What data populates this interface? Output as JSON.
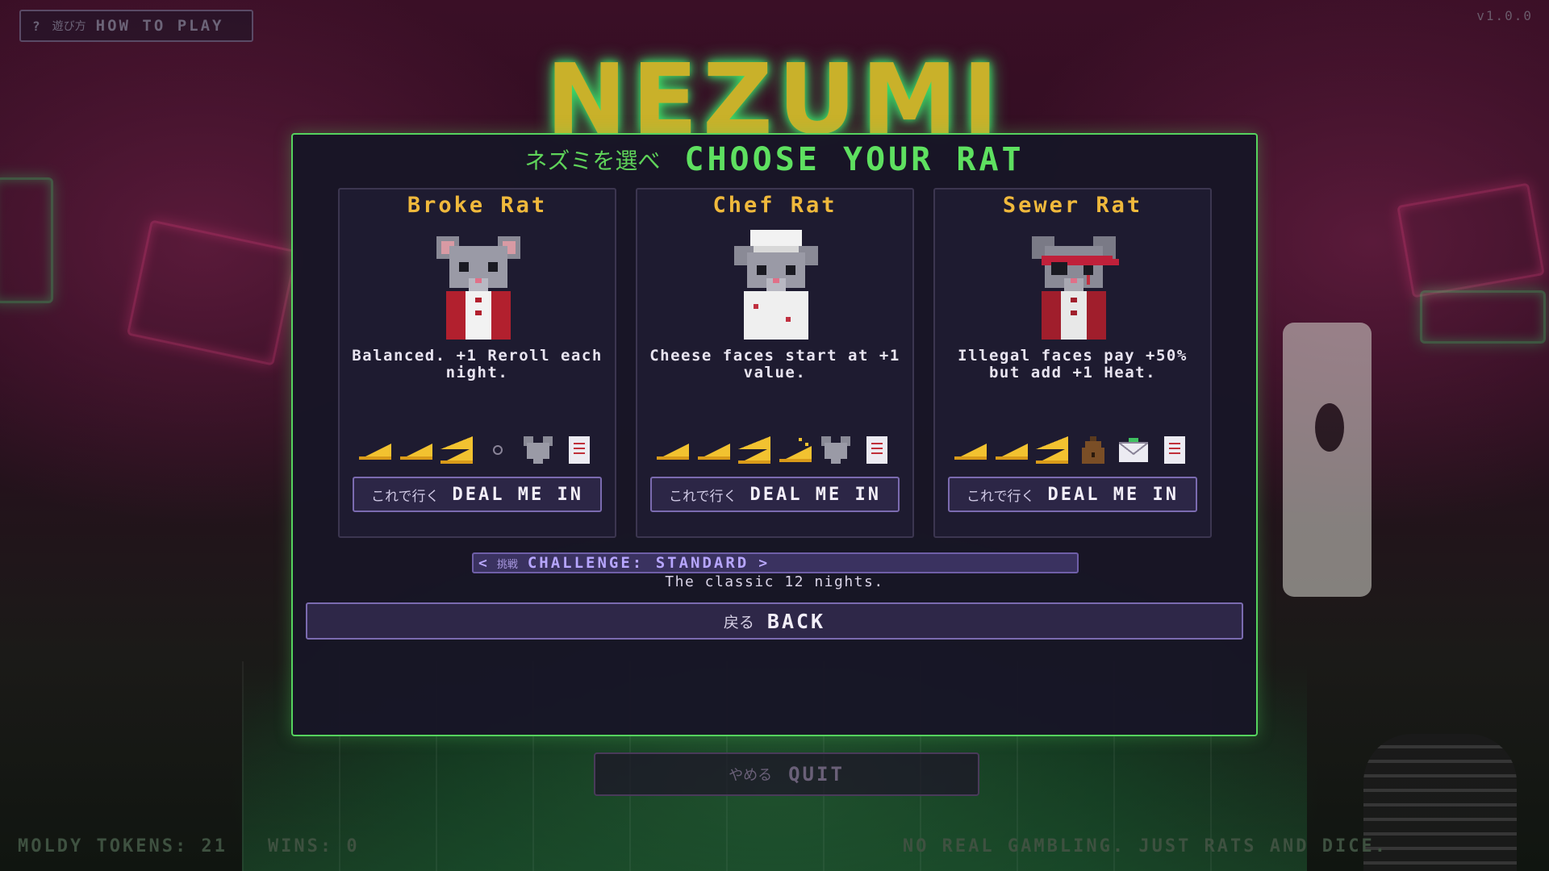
{
  "topbar": {
    "how_to_play_jp": "遊び方",
    "how_to_play_label": "HOW TO PLAY",
    "version": "v1.0.0"
  },
  "logo": "NEZUMI",
  "menu_behind": {
    "quit_jp": "やめる",
    "quit_label": "QUIT"
  },
  "footer": {
    "tokens": "MOLDY TOKENS: 21",
    "wins": "WINS: 0",
    "disclaimer": "NO REAL GAMBLING. JUST RATS AND DICE."
  },
  "modal": {
    "title_jp": "ネズミを選べ",
    "title": "CHOOSE YOUR RAT",
    "deal_jp": "これで行く",
    "deal_label": "DEAL ME IN",
    "rats": [
      {
        "name": "Broke Rat",
        "description": "Balanced. +1 Reroll each night.",
        "inventory": [
          "cheese-icon",
          "cheese-icon",
          "cheese-stack-icon",
          "empty-slot-icon",
          "rat-head-icon",
          "receipt-icon"
        ]
      },
      {
        "name": "Chef Rat",
        "description": "Cheese faces start at +1 value.",
        "inventory": [
          "cheese-icon",
          "cheese-icon",
          "cheese-stack-icon",
          "sparkle-cheese-icon",
          "rat-head-icon",
          "receipt-icon"
        ]
      },
      {
        "name": "Sewer Rat",
        "description": "Illegal faces pay +50% but add +1 Heat.",
        "inventory": [
          "cheese-icon",
          "cheese-icon",
          "cheese-stack-icon",
          "money-bag-icon",
          "envelope-icon",
          "receipt-icon"
        ]
      }
    ],
    "challenge": {
      "jp": "挑戦",
      "label": "CHALLENGE: STANDARD",
      "subtitle": "The classic 12 nights."
    },
    "back_jp": "戻る",
    "back_label": "BACK"
  },
  "colors": {
    "accent_green": "#55d35e",
    "rat_name": "#f0b93c",
    "button_border": "#7b6bb0"
  }
}
